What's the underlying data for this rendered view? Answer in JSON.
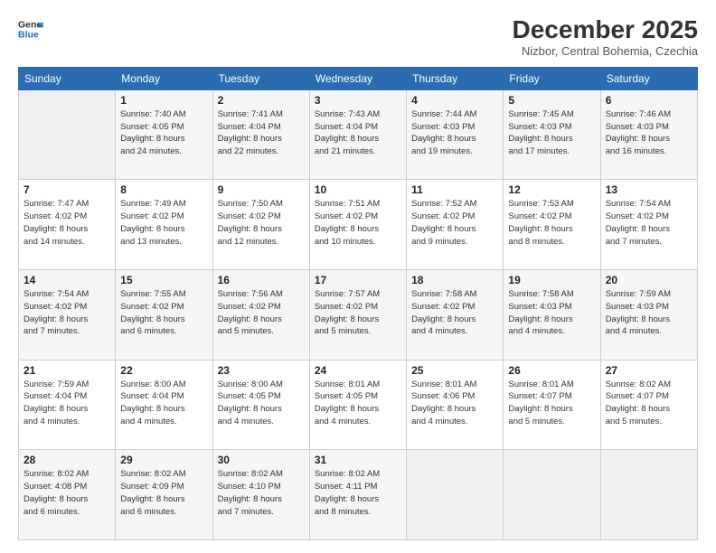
{
  "logo": {
    "line1": "General",
    "line2": "Blue"
  },
  "title": "December 2025",
  "subtitle": "Nizbor, Central Bohemia, Czechia",
  "days_header": [
    "Sunday",
    "Monday",
    "Tuesday",
    "Wednesday",
    "Thursday",
    "Friday",
    "Saturday"
  ],
  "weeks": [
    [
      {
        "num": "",
        "info": ""
      },
      {
        "num": "1",
        "info": "Sunrise: 7:40 AM\nSunset: 4:05 PM\nDaylight: 8 hours\nand 24 minutes."
      },
      {
        "num": "2",
        "info": "Sunrise: 7:41 AM\nSunset: 4:04 PM\nDaylight: 8 hours\nand 22 minutes."
      },
      {
        "num": "3",
        "info": "Sunrise: 7:43 AM\nSunset: 4:04 PM\nDaylight: 8 hours\nand 21 minutes."
      },
      {
        "num": "4",
        "info": "Sunrise: 7:44 AM\nSunset: 4:03 PM\nDaylight: 8 hours\nand 19 minutes."
      },
      {
        "num": "5",
        "info": "Sunrise: 7:45 AM\nSunset: 4:03 PM\nDaylight: 8 hours\nand 17 minutes."
      },
      {
        "num": "6",
        "info": "Sunrise: 7:46 AM\nSunset: 4:03 PM\nDaylight: 8 hours\nand 16 minutes."
      }
    ],
    [
      {
        "num": "7",
        "info": "Sunrise: 7:47 AM\nSunset: 4:02 PM\nDaylight: 8 hours\nand 14 minutes."
      },
      {
        "num": "8",
        "info": "Sunrise: 7:49 AM\nSunset: 4:02 PM\nDaylight: 8 hours\nand 13 minutes."
      },
      {
        "num": "9",
        "info": "Sunrise: 7:50 AM\nSunset: 4:02 PM\nDaylight: 8 hours\nand 12 minutes."
      },
      {
        "num": "10",
        "info": "Sunrise: 7:51 AM\nSunset: 4:02 PM\nDaylight: 8 hours\nand 10 minutes."
      },
      {
        "num": "11",
        "info": "Sunrise: 7:52 AM\nSunset: 4:02 PM\nDaylight: 8 hours\nand 9 minutes."
      },
      {
        "num": "12",
        "info": "Sunrise: 7:53 AM\nSunset: 4:02 PM\nDaylight: 8 hours\nand 8 minutes."
      },
      {
        "num": "13",
        "info": "Sunrise: 7:54 AM\nSunset: 4:02 PM\nDaylight: 8 hours\nand 7 minutes."
      }
    ],
    [
      {
        "num": "14",
        "info": "Sunrise: 7:54 AM\nSunset: 4:02 PM\nDaylight: 8 hours\nand 7 minutes."
      },
      {
        "num": "15",
        "info": "Sunrise: 7:55 AM\nSunset: 4:02 PM\nDaylight: 8 hours\nand 6 minutes."
      },
      {
        "num": "16",
        "info": "Sunrise: 7:56 AM\nSunset: 4:02 PM\nDaylight: 8 hours\nand 5 minutes."
      },
      {
        "num": "17",
        "info": "Sunrise: 7:57 AM\nSunset: 4:02 PM\nDaylight: 8 hours\nand 5 minutes."
      },
      {
        "num": "18",
        "info": "Sunrise: 7:58 AM\nSunset: 4:02 PM\nDaylight: 8 hours\nand 4 minutes."
      },
      {
        "num": "19",
        "info": "Sunrise: 7:58 AM\nSunset: 4:03 PM\nDaylight: 8 hours\nand 4 minutes."
      },
      {
        "num": "20",
        "info": "Sunrise: 7:59 AM\nSunset: 4:03 PM\nDaylight: 8 hours\nand 4 minutes."
      }
    ],
    [
      {
        "num": "21",
        "info": "Sunrise: 7:59 AM\nSunset: 4:04 PM\nDaylight: 8 hours\nand 4 minutes."
      },
      {
        "num": "22",
        "info": "Sunrise: 8:00 AM\nSunset: 4:04 PM\nDaylight: 8 hours\nand 4 minutes."
      },
      {
        "num": "23",
        "info": "Sunrise: 8:00 AM\nSunset: 4:05 PM\nDaylight: 8 hours\nand 4 minutes."
      },
      {
        "num": "24",
        "info": "Sunrise: 8:01 AM\nSunset: 4:05 PM\nDaylight: 8 hours\nand 4 minutes."
      },
      {
        "num": "25",
        "info": "Sunrise: 8:01 AM\nSunset: 4:06 PM\nDaylight: 8 hours\nand 4 minutes."
      },
      {
        "num": "26",
        "info": "Sunrise: 8:01 AM\nSunset: 4:07 PM\nDaylight: 8 hours\nand 5 minutes."
      },
      {
        "num": "27",
        "info": "Sunrise: 8:02 AM\nSunset: 4:07 PM\nDaylight: 8 hours\nand 5 minutes."
      }
    ],
    [
      {
        "num": "28",
        "info": "Sunrise: 8:02 AM\nSunset: 4:08 PM\nDaylight: 8 hours\nand 6 minutes."
      },
      {
        "num": "29",
        "info": "Sunrise: 8:02 AM\nSunset: 4:09 PM\nDaylight: 8 hours\nand 6 minutes."
      },
      {
        "num": "30",
        "info": "Sunrise: 8:02 AM\nSunset: 4:10 PM\nDaylight: 8 hours\nand 7 minutes."
      },
      {
        "num": "31",
        "info": "Sunrise: 8:02 AM\nSunset: 4:11 PM\nDaylight: 8 hours\nand 8 minutes."
      },
      {
        "num": "",
        "info": ""
      },
      {
        "num": "",
        "info": ""
      },
      {
        "num": "",
        "info": ""
      }
    ]
  ]
}
